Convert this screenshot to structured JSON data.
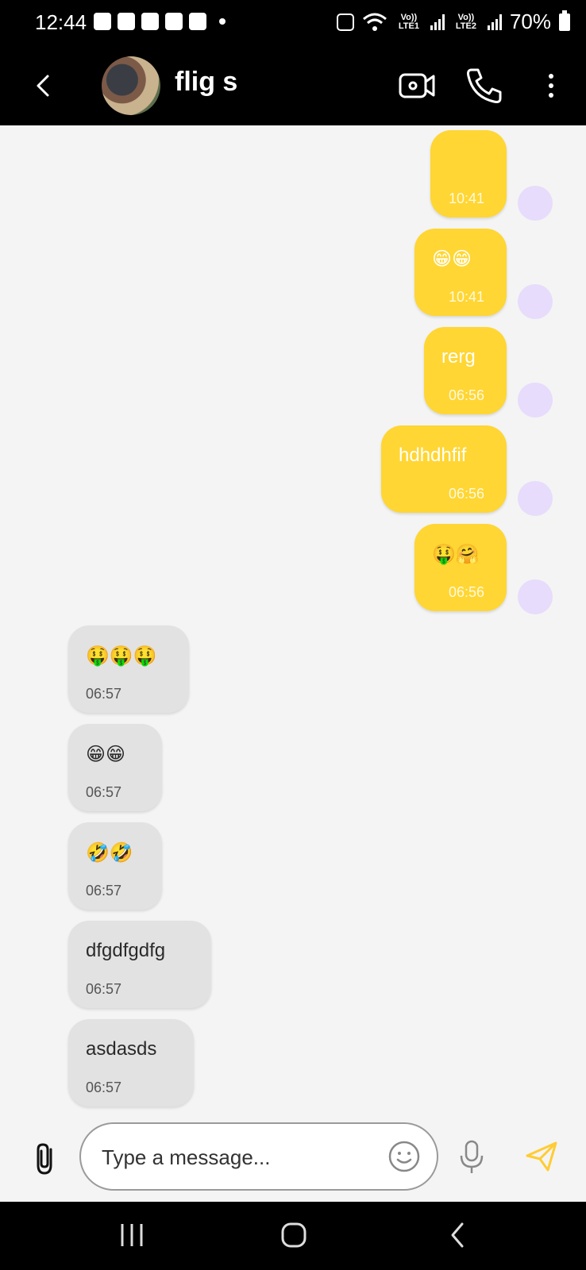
{
  "status_bar": {
    "time": "12:44",
    "lte1": "Vo)) LTE1",
    "lte2": "Vo)) LTE2",
    "battery": "70%"
  },
  "header": {
    "contact_name": "flig s",
    "icons": [
      "back-arrow-icon",
      "video-call-icon",
      "phone-call-icon",
      "more-vert-icon"
    ]
  },
  "messages": [
    {
      "direction": "out",
      "text": "",
      "time": "10:41"
    },
    {
      "direction": "out",
      "text": "😁😁",
      "time": "10:41"
    },
    {
      "direction": "out",
      "text": "rerg",
      "time": "06:56"
    },
    {
      "direction": "out",
      "text": "hdhdhfif",
      "time": "06:56"
    },
    {
      "direction": "out",
      "text": "🤑🤗",
      "time": "06:56"
    },
    {
      "direction": "in",
      "text": "🤑🤑🤑",
      "time": "06:57"
    },
    {
      "direction": "in",
      "text": "😁😁",
      "time": "06:57"
    },
    {
      "direction": "in",
      "text": "🤣🤣",
      "time": "06:57"
    },
    {
      "direction": "in",
      "text": "dfgdfgdfg",
      "time": "06:57"
    },
    {
      "direction": "in",
      "text": "asdasds",
      "time": "06:57"
    }
  ],
  "composer": {
    "placeholder": "Type a message...",
    "icons": [
      "paperclip-icon",
      "emoji-icon",
      "microphone-icon",
      "send-icon"
    ]
  },
  "colors": {
    "outgoing_bubble": "#ffd633",
    "incoming_bubble": "#e2e2e2",
    "read_indicator": "#e7dcfb",
    "send_accent": "#ffcc33"
  }
}
